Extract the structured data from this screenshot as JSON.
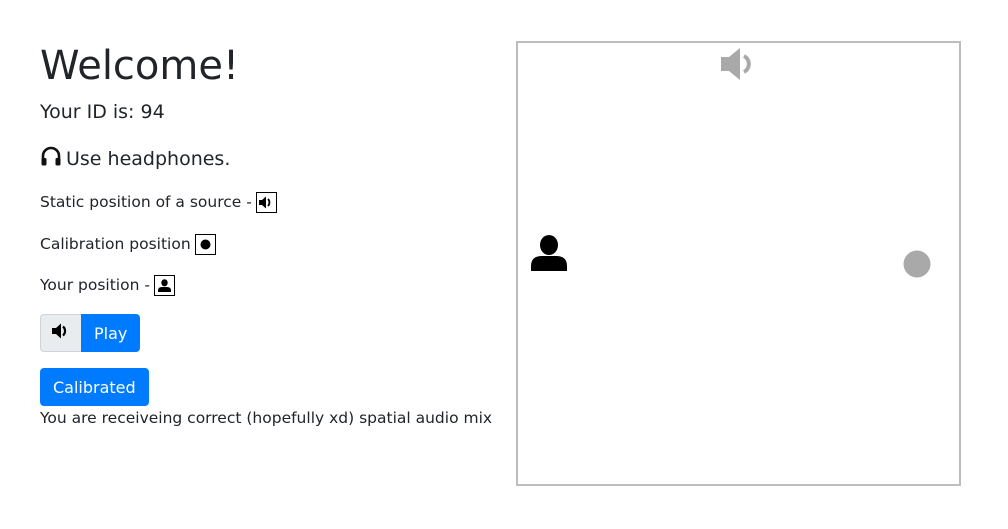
{
  "title": "Welcome!",
  "id_line": "Your ID is: 94",
  "headphones_text": "Use headphones.",
  "legend": {
    "source": "Static position of a source -",
    "calibration": "Calibration position",
    "user": "Your position -"
  },
  "play_button": "Play",
  "calibrated_button": "Calibrated",
  "status_text": "You are receiveing correct (hopefully xd) spatial audio mix",
  "icons": {
    "headphones": "headphones-icon",
    "source": "volume-icon",
    "calibration": "dot-icon",
    "user": "user-icon"
  },
  "colors": {
    "primary": "#007bff",
    "canvas_border": "#bdbdbd",
    "source_marker": "#a9a9a9",
    "calibration_marker": "#a9a9a9",
    "user_marker": "#000000"
  }
}
